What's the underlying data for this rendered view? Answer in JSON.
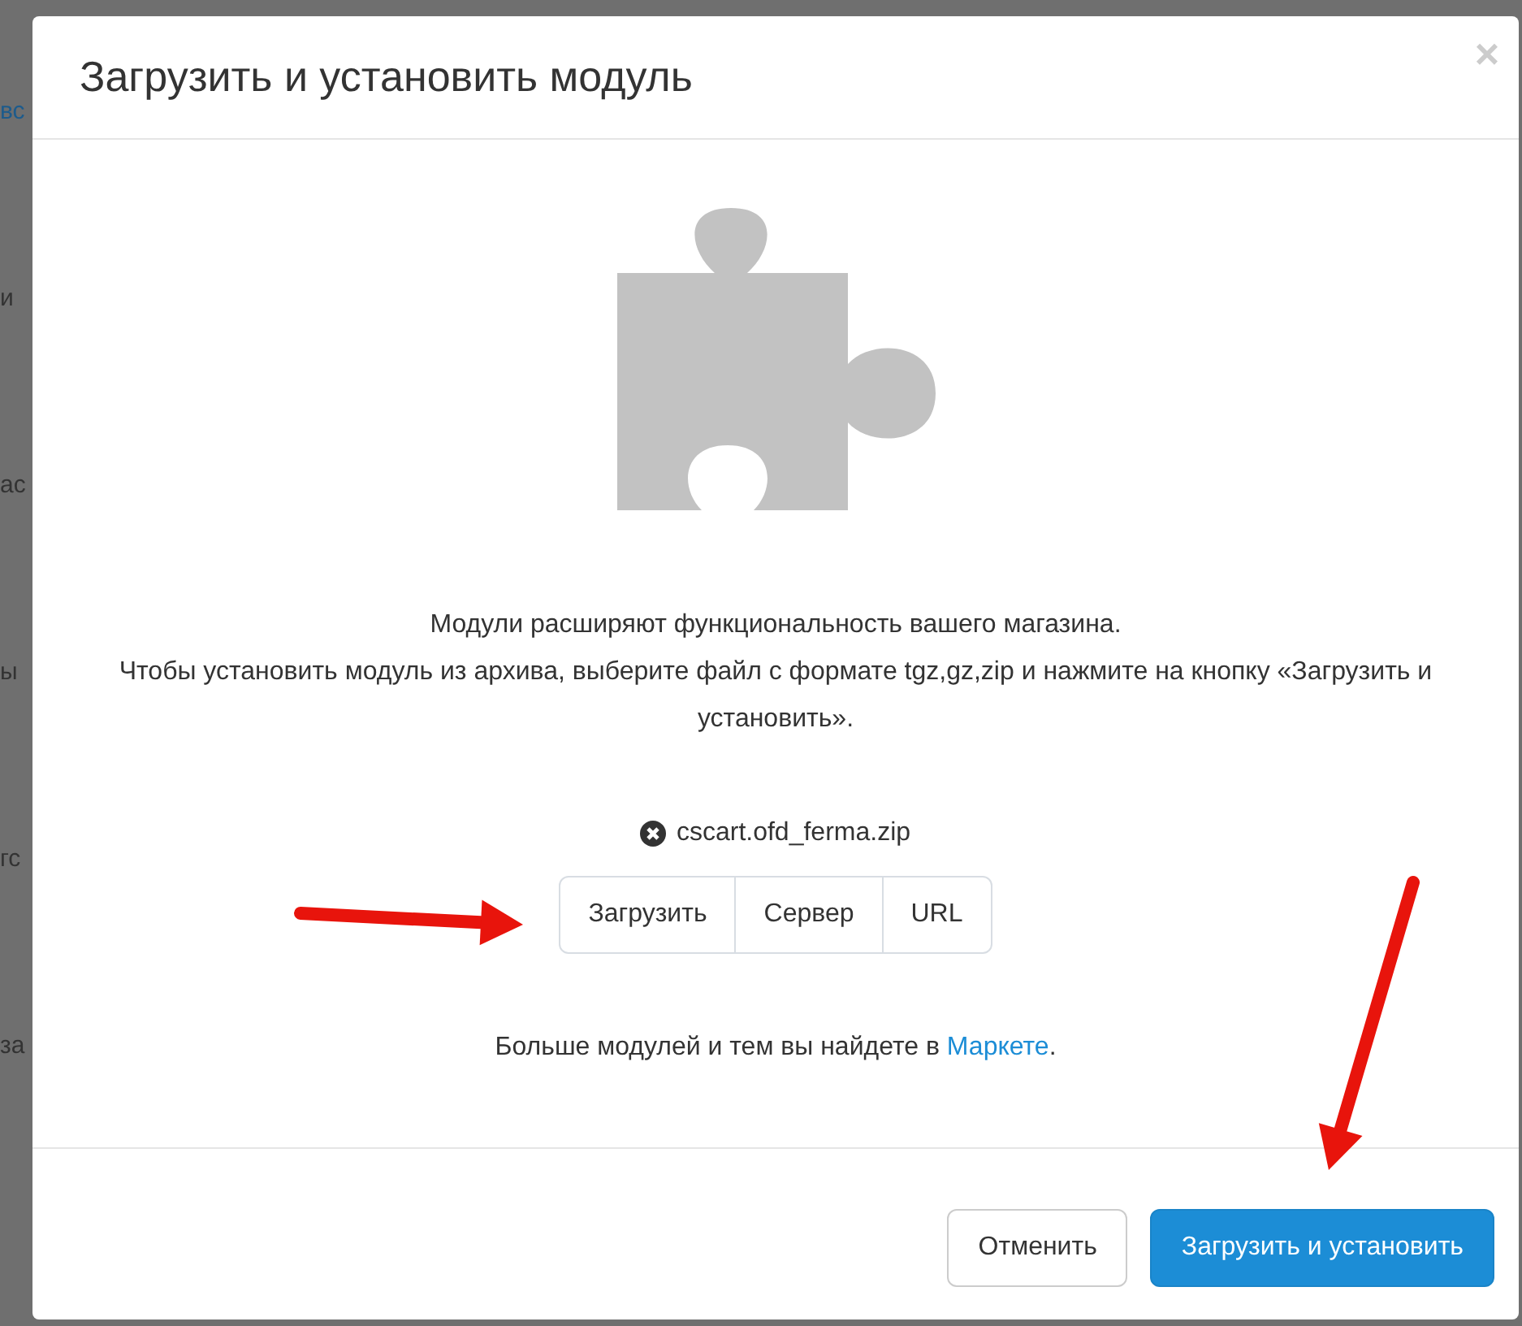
{
  "backdrop": {
    "fragments": [
      {
        "text": "вс",
        "kind": "link"
      },
      {
        "text": "и",
        "kind": "text"
      },
      {
        "text": "ас",
        "kind": "text"
      },
      {
        "text": "ы",
        "kind": "text"
      },
      {
        "text": "гс",
        "kind": "text"
      },
      {
        "text": "за",
        "kind": "text"
      }
    ]
  },
  "modal": {
    "title": "Загрузить и установить модуль",
    "close": "×",
    "description": [
      "Модули расширяют функциональность вашего магазина.",
      "Чтобы установить модуль из архива, выберите файл с формате tgz,gz,zip и нажмите на кнопку «Загрузить и установить»."
    ],
    "file": {
      "name": "cscart.ofd_ferma.zip"
    },
    "source_buttons": [
      "Загрузить",
      "Сервер",
      "URL"
    ],
    "more": {
      "text": "Больше модулей и тем вы найдете в ",
      "link": "Маркете",
      "after": "."
    },
    "footer_buttons": [
      {
        "label": "Отменить",
        "kind": "secondary"
      },
      {
        "label": "Загрузить и установить",
        "kind": "primary"
      }
    ]
  },
  "annotations": [
    {
      "kind": "arrow"
    },
    {
      "kind": "arrow"
    }
  ]
}
